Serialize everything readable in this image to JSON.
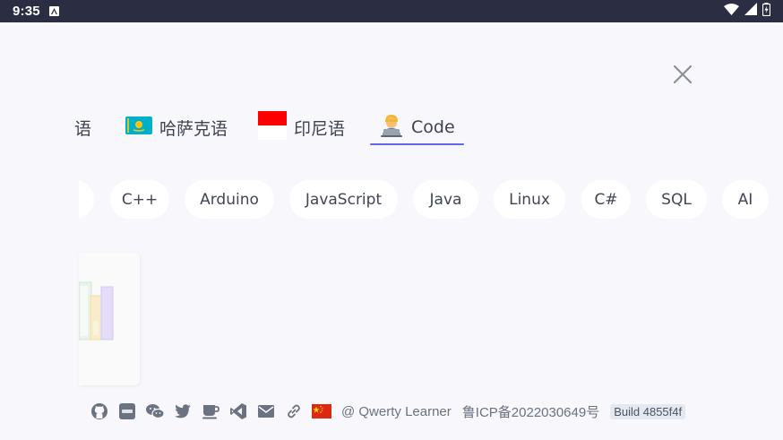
{
  "status_bar": {
    "time": "9:35"
  },
  "tabs": {
    "items": [
      {
        "label": "语"
      },
      {
        "flag": "🇰🇿",
        "label": "哈萨克语"
      },
      {
        "label": "印尼语"
      },
      {
        "flag": "🧑‍💻",
        "label": "Code",
        "selected": true
      }
    ]
  },
  "chips": {
    "items": [
      "C++",
      "Arduino",
      "JavaScript",
      "Java",
      "Linux",
      "C#",
      "SQL",
      "AI"
    ]
  },
  "footer": {
    "icons": [
      "github-icon",
      "discord-icon",
      "wechat-icon",
      "twitter-icon",
      "coffee-icon",
      "vscode-icon",
      "mail-icon",
      "link-icon",
      "china-flag-icon"
    ],
    "credit": "@ Qwerty Learner",
    "icp": "鲁ICP备2022030649号",
    "build": "Build 4855f4f"
  },
  "colors": {
    "accent": "#6366f1",
    "status_bar": "#2b2d42",
    "background": "#f7f7fc"
  }
}
